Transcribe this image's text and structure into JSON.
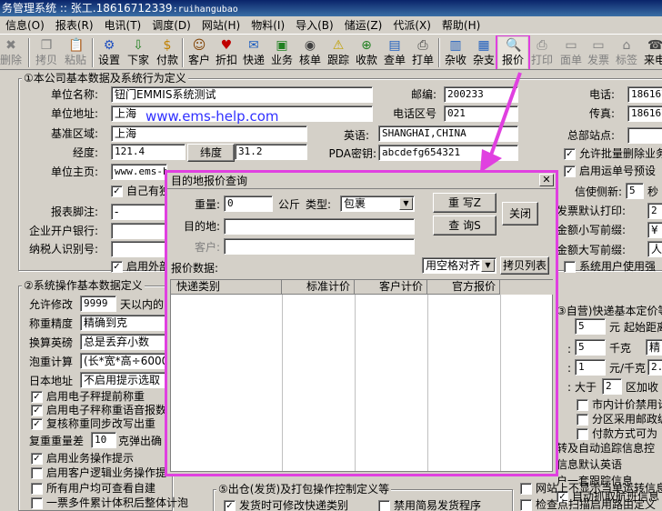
{
  "window": {
    "title_left": "务管理系统",
    "title_sep": "::",
    "user": "张工.18616712339",
    "account": ":ruihangubao"
  },
  "menu": [
    "信息(O)",
    "报表(R)",
    "电讯(T)",
    "调度(D)",
    "网站(H)",
    "物料(I)",
    "导入(B)",
    "储运(Z)",
    "代派(X)",
    "帮助(H)"
  ],
  "toolbar": {
    "delete": "删除",
    "copy": "拷贝",
    "paste": "粘贴",
    "settings": "设置",
    "download": "下家",
    "pay": "付款",
    "customer": "客户",
    "discount": "折扣",
    "express": "快递",
    "business": "业务",
    "verify": "核单",
    "track": "跟踪",
    "collect": "收款",
    "query": "查单",
    "print_order": "打单",
    "misc_collect": "杂收",
    "misc_pay": "杂支",
    "quote": "报价",
    "print": "打印",
    "sheet": "面单",
    "invoice": "发票",
    "label": "标签",
    "call": "来电"
  },
  "section1": {
    "title": "①本公司基本数据及系统行为定义",
    "unit_name_label": "单位名称:",
    "unit_name": "钮门EMMIS系统测试",
    "postcode_label": "邮编:",
    "postcode": "200233",
    "phone_label": "电话:",
    "phone": "186167",
    "address_label": "单位地址:",
    "address": "上海",
    "area_code_label": "电话区号",
    "area_code": "021",
    "fax_label": "传真:",
    "fax": "186167",
    "region_label": "基准区域:",
    "region": "上海",
    "english_label": "英语:",
    "english": "SHANGHAI,CHINA",
    "hq_label": "总部站点:",
    "longitude_label": "经度:",
    "longitude": "121.4",
    "latitude_label": "纬度",
    "latitude": "31.2",
    "pda_label": "PDA密钥:",
    "pda": "abcdefg654321",
    "homepage_label": "单位主页:",
    "homepage": "www.ems-hel",
    "allow_batch_delete": "允许批量删除业务",
    "enable_waybill": "启用运单号预设",
    "self_label": "自己有独",
    "footer_label": "报表脚注:",
    "footer": "-",
    "bank_label": "企业开户银行:",
    "tax_label": "纳税人识别号:",
    "use_external": "启用外部",
    "sms_suffix_label": "信使侧新:",
    "sms_suffix_value": "5",
    "sms_suffix_unit": "秒",
    "default_print_label": "发票默认打印:",
    "default_print_value": "2",
    "small_prefix_label": "金额小写前缀:",
    "small_prefix_value": "¥",
    "big_prefix_label": "金额大写前缀:",
    "big_prefix_value": "人",
    "system_user": "系统用户使用强"
  },
  "watermark": "www.ems-help.com",
  "section2": {
    "title": "②系统操作基本数据定义",
    "allow_edit_label": "允许修改",
    "allow_edit_value": "9999",
    "allow_edit_suffix": "天以内的",
    "weight_precision_label": "称重精度",
    "weight_precision_value": "精确到克",
    "conversion_label": "换算英磅",
    "conversion_value": "总是丢弃小数",
    "bubble_label": "泡重计算",
    "bubble_value": "(长*宽*高÷6000",
    "japan_label": "日本地址",
    "japan_value": "不启用提示选取",
    "enable_scale": "启用电子秤提前称重",
    "enable_voice": "启用电子秤称重语音报数",
    "sync_weight": "复核称重同步改写出重",
    "dup_label": "复重重量差",
    "dup_value": "10",
    "dup_suffix": "克弹出确",
    "enable_biz": "启用业务操作提示",
    "enable_customer": "启用客户逻辑业务操作提",
    "all_users": "所有用户均可查看自建",
    "multi_ticket": "一票多件累计体积后整体计泡"
  },
  "section_right": {
    "title": "③自营)快递基本定价等",
    "first_value": "5",
    "first_unit": "元",
    "first_suffix": "起始距离",
    "second_value": "5",
    "second_unit": "千克",
    "second_extra": "精",
    "third_value": "1",
    "third_unit": "元/千克",
    "third_extra": "2.",
    "gt_label": "大于",
    "gt_value": "2",
    "gt_suffix": "区加收",
    "city_price": "市内计价禁用计",
    "zone_postcode": "分区采用邮政编",
    "pay_method": "付款方式可为",
    "auto_track": "转及自动追踪信息控",
    "default_english": "信息默认英语",
    "one_key_track": "户一套跟踪信息",
    "auto_capture": "自动抓取航班信息",
    "site_not_show": "网站上不显示当单运转信息",
    "scan_route": "检查点扫描启用路由定义"
  },
  "section5": {
    "title": "⑤出仓(发货)及打包操作控制定义等",
    "allow_change": "发货时可修改快递类别",
    "disable_simple": "禁用简易发货程序"
  },
  "dialog": {
    "title": "目的地报价查询",
    "weight_label": "重量:",
    "weight_value": "0",
    "weight_unit": "公斤",
    "type_label": "类型:",
    "type_value": "包裹",
    "dest_label": "目的地:",
    "customer_label": "客户:",
    "reset_button": "重 写Z",
    "query_button": "查 询S",
    "close_button": "关闭",
    "quote_data_label": "报价数据:",
    "align_value": "用空格对齐",
    "copy_list_button": "拷贝列表",
    "columns": [
      "快递类别",
      "标准计价",
      "客户计价",
      "官方报价"
    ]
  }
}
